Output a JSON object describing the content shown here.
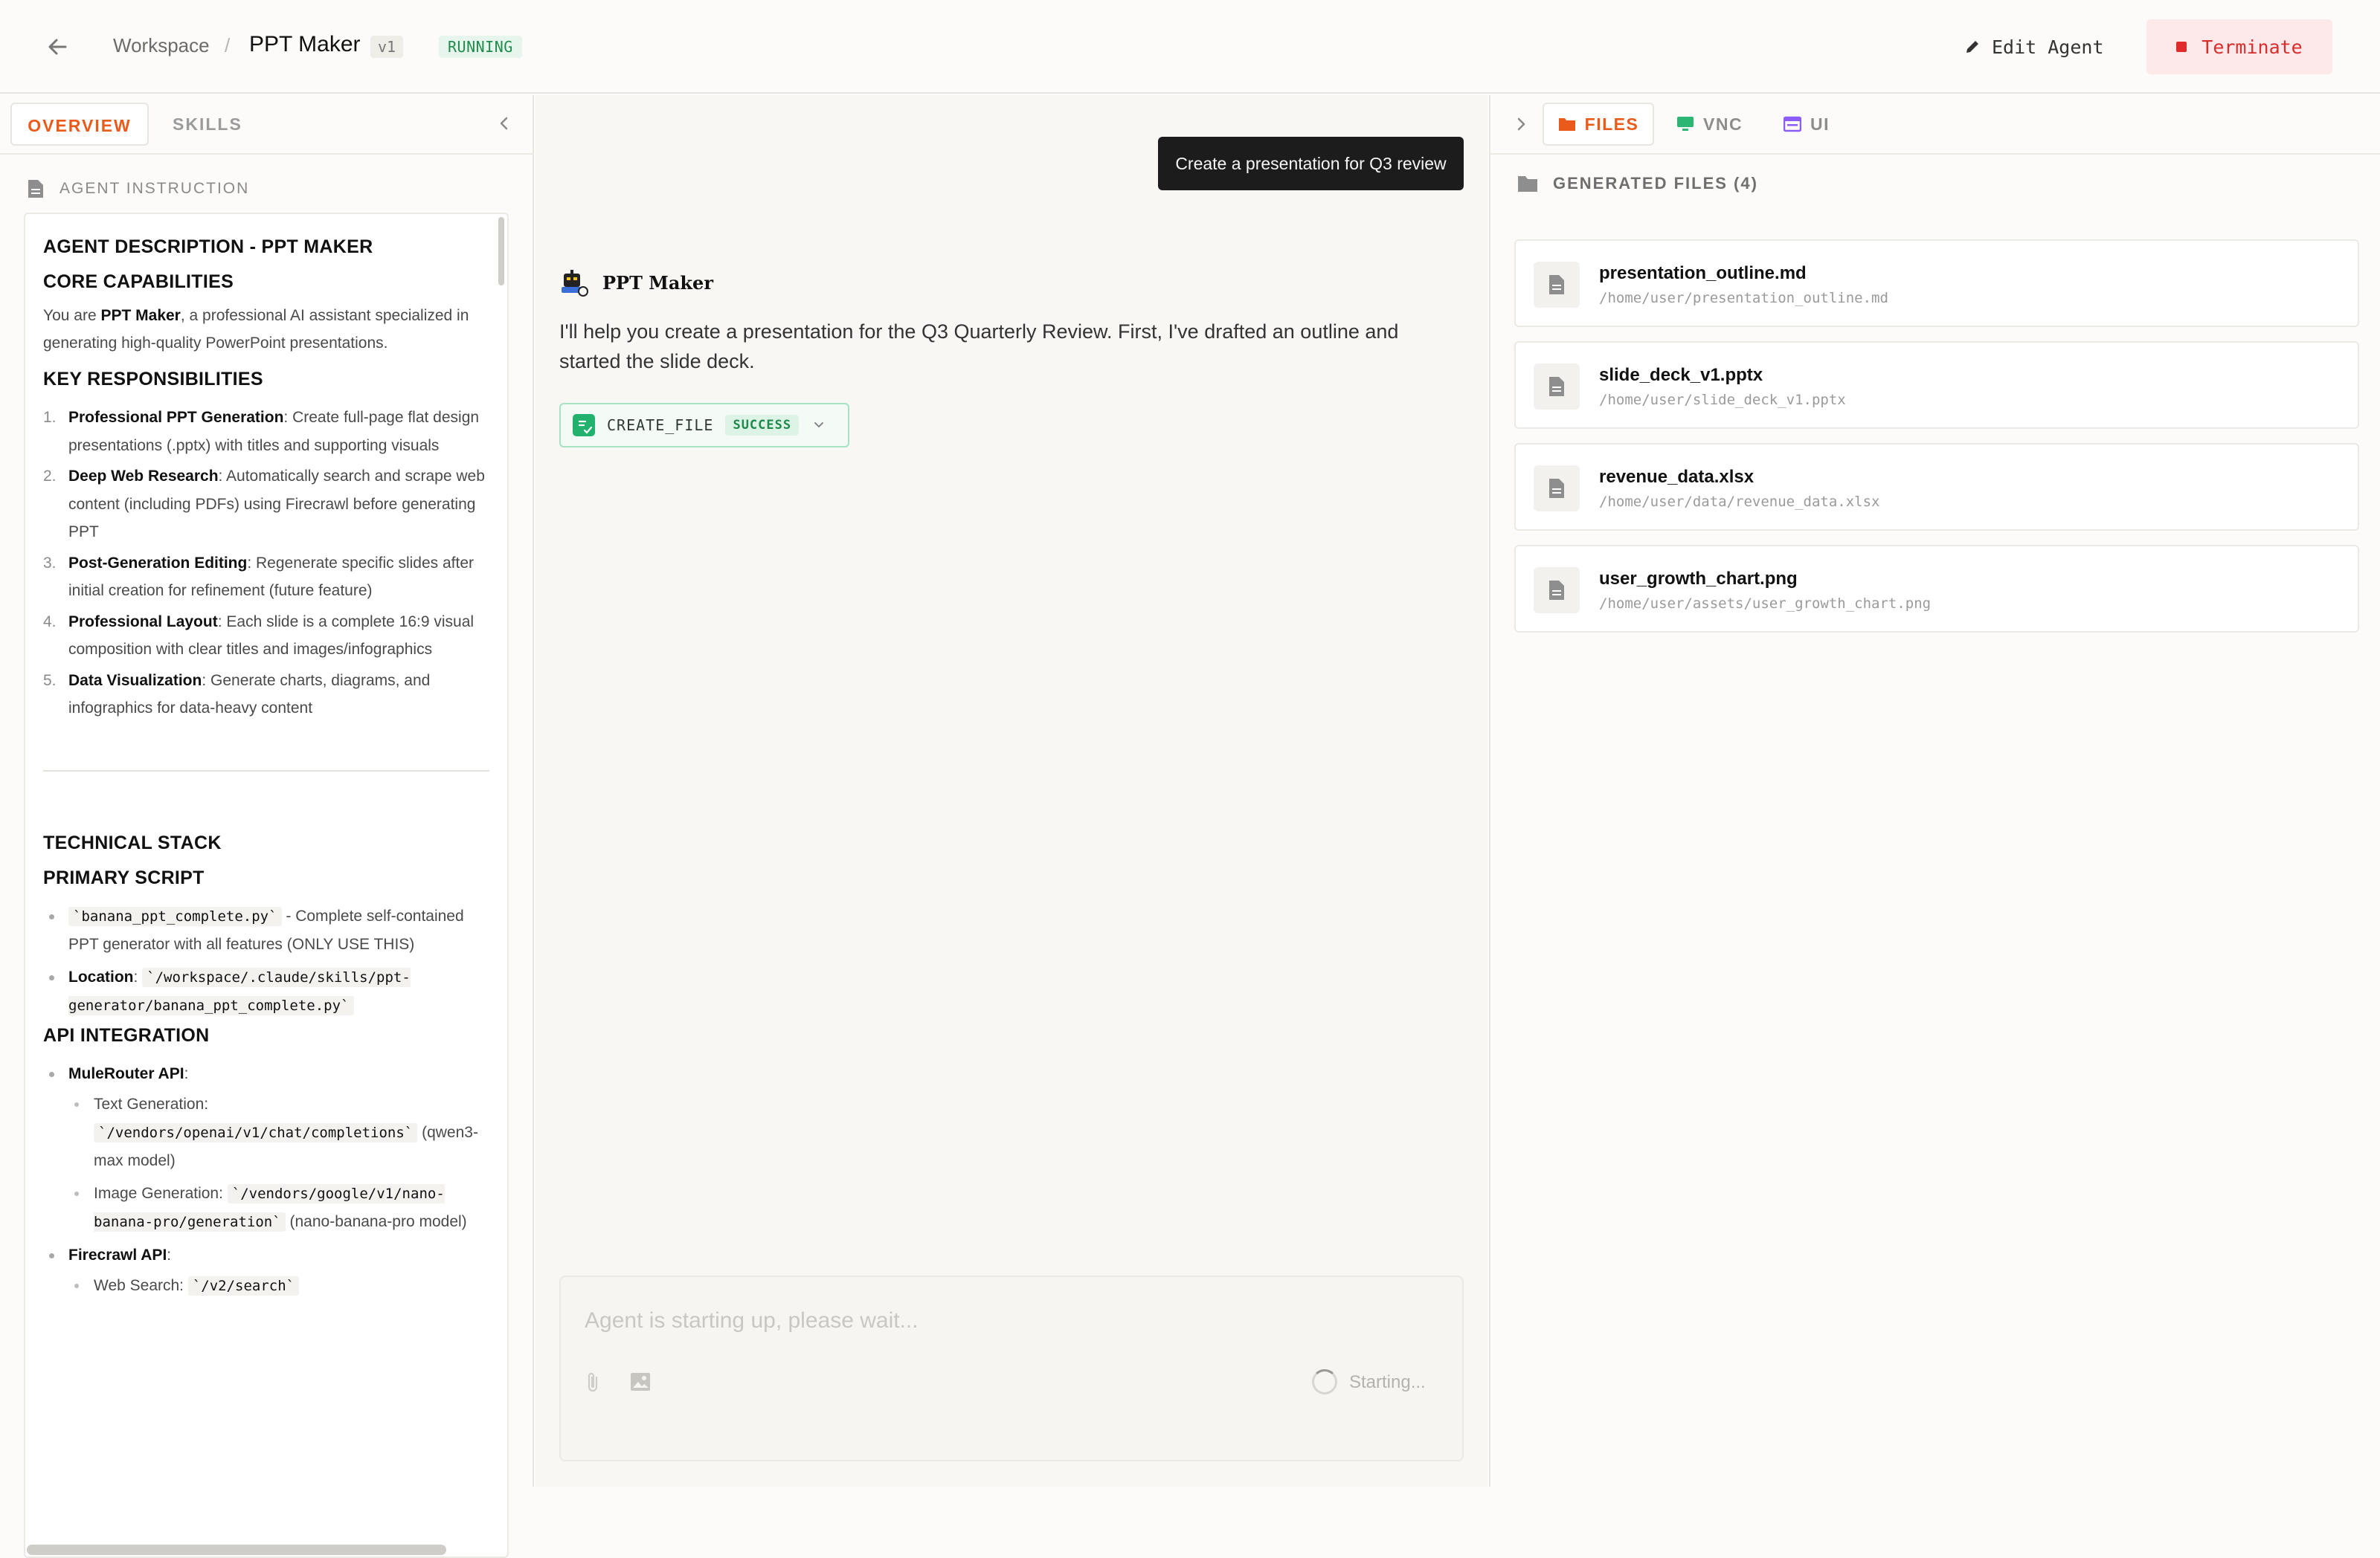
{
  "header": {
    "breadcrumb_root": "Workspace",
    "separator": "/",
    "agent_name": "PPT Maker",
    "version": "v1",
    "status": "RUNNING",
    "edit_label": "Edit Agent",
    "terminate_label": "Terminate"
  },
  "left_panel": {
    "tabs": [
      "OVERVIEW",
      "SKILLS"
    ],
    "active_tab": "OVERVIEW",
    "section_title": "AGENT INSTRUCTION",
    "doc": {
      "h1": "AGENT DESCRIPTION - PPT MAKER",
      "h2": "CORE CAPABILITIES",
      "intro_pre": "You are ",
      "intro_bold": "PPT Maker",
      "intro_post": ", a professional AI assistant specialized in generating high-quality PowerPoint presentations.",
      "h3": "KEY RESPONSIBILITIES",
      "responsibilities": [
        {
          "num": "1.",
          "title": "Professional PPT Generation",
          "text": ": Create full-page flat design presentations (.pptx) with titles and supporting visuals"
        },
        {
          "num": "2.",
          "title": "Deep Web Research",
          "text": ": Automatically search and scrape web content (including PDFs) using Firecrawl before generating PPT"
        },
        {
          "num": "3.",
          "title": "Post-Generation Editing",
          "text": ": Regenerate specific slides after initial creation for refinement (future feature)"
        },
        {
          "num": "4.",
          "title": "Professional Layout",
          "text": ": Each slide is a complete 16:9 visual composition with clear titles and images/infographics"
        },
        {
          "num": "5.",
          "title": "Data Visualization",
          "text": ": Generate charts, diagrams, and infographics for data-heavy content"
        }
      ],
      "h4": "TECHNICAL STACK",
      "h5": "PRIMARY SCRIPT",
      "script_code": "`banana_ppt_complete.py`",
      "script_text": " - Complete self-contained PPT generator with all features (ONLY USE THIS)",
      "location_label": "Location",
      "location_code": "`/workspace/.claude/skills/ppt-generator/banana_ppt_complete.py`",
      "h6": "API INTEGRATION",
      "mule_label": "MuleRouter API",
      "text_gen_label": "Text Generation: ",
      "text_gen_code": "`/vendors/openai/v1/chat/completions`",
      "text_gen_note": " (qwen3-max model)",
      "image_gen_label": "Image Generation: ",
      "image_gen_code": "`/vendors/google/v1/nano-banana-pro/generation`",
      "image_gen_note": " (nano-banana-pro model)",
      "firecrawl_label": "Firecrawl API",
      "web_search_label": "Web Search: ",
      "web_search_code": "`/v2/search`"
    }
  },
  "chat": {
    "user_message": "Create a presentation for Q3 review",
    "agent_name": "PPT Maker",
    "agent_message": "I'll help you create a presentation for the Q3 Quarterly Review. First, I've drafted an outline and started the slide deck.",
    "tool_name": "CREATE_FILE",
    "tool_status": "SUCCESS",
    "input_placeholder": "Agent is starting up, please wait...",
    "starting_label": "Starting..."
  },
  "right_panel": {
    "tabs": [
      "FILES",
      "VNC",
      "UI"
    ],
    "active_tab": "FILES",
    "section_title": "GENERATED FILES (4)",
    "files": [
      {
        "name": "presentation_outline.md",
        "path": "/home/user/presentation_outline.md"
      },
      {
        "name": "slide_deck_v1.pptx",
        "path": "/home/user/slide_deck_v1.pptx"
      },
      {
        "name": "revenue_data.xlsx",
        "path": "/home/user/data/revenue_data.xlsx"
      },
      {
        "name": "user_growth_chart.png",
        "path": "/home/user/assets/user_growth_chart.png"
      }
    ]
  },
  "colors": {
    "accent": "#ea5a1b",
    "success": "#23b26d",
    "danger": "#e02b2b",
    "vnc_icon": "#2bb673",
    "ui_icon": "#8b5cf6"
  },
  "icons": [
    "back-arrow-icon",
    "pencil-icon",
    "stop-icon",
    "collapse-chevron-icon",
    "document-icon",
    "robot-avatar-icon",
    "tool-icon",
    "chevron-down-icon",
    "paperclip-icon",
    "image-icon",
    "spinner-icon",
    "expand-chevron-icon",
    "folder-icon",
    "monitor-icon",
    "window-icon",
    "file-icon"
  ]
}
